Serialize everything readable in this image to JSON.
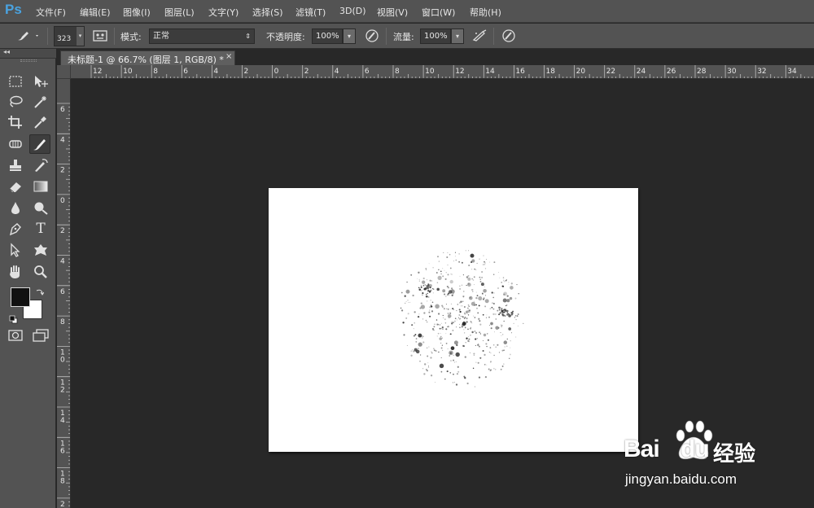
{
  "app": {
    "logo": "Ps",
    "menu": [
      "文件(F)",
      "编辑(E)",
      "图像(I)",
      "图层(L)",
      "文字(Y)",
      "选择(S)",
      "滤镜(T)",
      "3D(D)",
      "视图(V)",
      "窗口(W)",
      "帮助(H)"
    ]
  },
  "options": {
    "brush_size": "323",
    "mode_label": "模式:",
    "mode_value": "正常",
    "opacity_label": "不透明度:",
    "opacity_value": "100%",
    "flow_label": "流量:",
    "flow_value": "100%"
  },
  "toolbar": {
    "collapse_label": "◂◂",
    "tools": [
      "rectangular-marquee",
      "move",
      "lasso",
      "magic-wand",
      "crop",
      "eyedropper",
      "spot-healing",
      "brush",
      "clone-stamp",
      "history-brush",
      "eraser",
      "gradient",
      "blur",
      "dodge",
      "pen",
      "type",
      "path-selection",
      "custom-shape",
      "hand",
      "zoom"
    ],
    "type_tool_glyph": "T",
    "foreground_color": "#111111",
    "background_color": "#ffffff"
  },
  "document": {
    "tab_title": "未标题-1 @ 66.7% (图层 1, RGB/8) *",
    "close_glyph": "×"
  },
  "rulers": {
    "horizontal": [
      "12",
      "10",
      "8",
      "6",
      "4",
      "2",
      "0",
      "2",
      "4",
      "6",
      "8",
      "10",
      "12",
      "14",
      "16",
      "18",
      "20",
      "22",
      "24",
      "26",
      "28",
      "30",
      "32",
      "34"
    ],
    "vertical": [
      "6",
      "4",
      "2",
      "0",
      "2",
      "4",
      "6",
      "8",
      "10",
      "12",
      "14",
      "16",
      "18",
      "20"
    ]
  },
  "watermark": {
    "brand": "Bai",
    "brand_suffix": "du",
    "product": "经验",
    "url": "jingyan.baidu.com"
  }
}
